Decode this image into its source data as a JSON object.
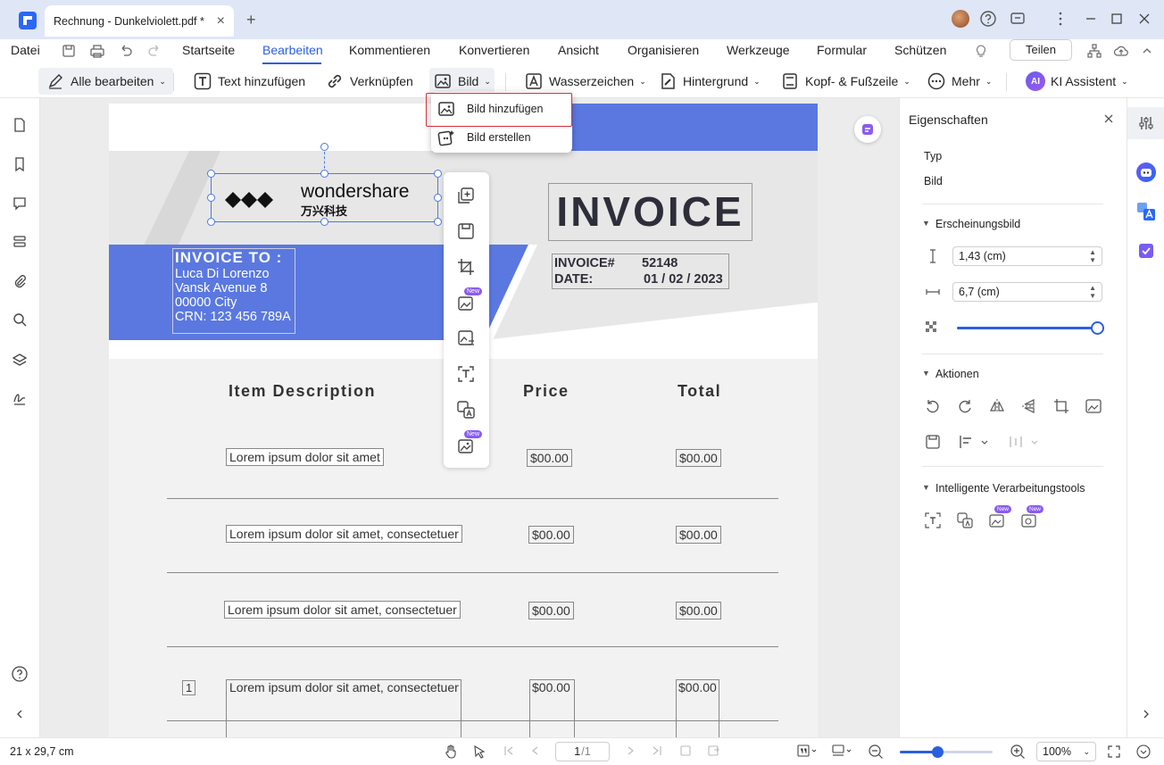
{
  "titlebar": {
    "tab_title": "Rechnung - Dunkelviolett.pdf *",
    "close_glyph": "×",
    "new_tab_glyph": "+"
  },
  "menubar": {
    "datei": "Datei",
    "items": [
      "Startseite",
      "Bearbeiten",
      "Kommentieren",
      "Konvertieren",
      "Ansicht",
      "Organisieren",
      "Werkzeuge",
      "Formular",
      "Schützen"
    ],
    "share": "Teilen"
  },
  "toolbar": {
    "edit_all": "Alle bearbeiten",
    "add_text": "Text hinzufügen",
    "link": "Verknüpfen",
    "image": "Bild",
    "watermark": "Wasserzeichen",
    "background": "Hintergrund",
    "header_footer": "Kopf- & Fußzeile",
    "more": "Mehr",
    "ai": "KI Assistent",
    "ai_badge": "AI"
  },
  "dropdown": {
    "add_image": "Bild hinzufügen",
    "create_image": "Bild erstellen"
  },
  "document": {
    "logo_text": "wondershare",
    "logo_cn": "万兴科技",
    "invoice_title": "INVOICE",
    "invoice_to_label": "INVOICE TO :",
    "client_name": "Luca Di Lorenzo",
    "client_street": "Vansk Avenue 8",
    "client_city": "00000 City",
    "client_crn": "CRN: 123 456 789A",
    "invoice_no_label": "INVOICE#",
    "invoice_no": "52148",
    "date_label": "DATE:",
    "date_value": "01 / 02 / 2023",
    "col_desc": "Item Description",
    "col_price": "Price",
    "col_total": "Total",
    "rows": [
      {
        "desc": "Lorem ipsum dolor sit amet",
        "price": "$00.00",
        "total": "$00.00"
      },
      {
        "desc": "Lorem ipsum dolor sit amet, consectetuer",
        "price": "$00.00",
        "total": "$00.00"
      },
      {
        "desc": "Lorem ipsum dolor sit amet, consectetuer",
        "price": "$00.00",
        "total": "$00.00"
      },
      {
        "num": "1",
        "desc": "Lorem ipsum dolor sit amet, consectetuer",
        "price": "$00.00",
        "total": "$00.00"
      }
    ]
  },
  "floatbar": {
    "new_badge": "New"
  },
  "properties": {
    "title": "Eigenschaften",
    "type_label": "Typ",
    "type_value": "Bild",
    "appearance": "Erscheinungsbild",
    "height_value": "1,43 (cm)",
    "width_value": "6,7 (cm)",
    "opacity_percent": 100,
    "actions": "Aktionen",
    "smart_tools": "Intelligente Verarbeitungstools",
    "new_badge": "New"
  },
  "statusbar": {
    "page_size": "21 x 29,7 cm",
    "page_input": "1",
    "page_total": "/1",
    "zoom": "100%",
    "zoom_level": 0.4
  },
  "colors": {
    "accent": "#2b5fe0",
    "banner": "#5a78e0",
    "highlight": "#d32f3a"
  }
}
